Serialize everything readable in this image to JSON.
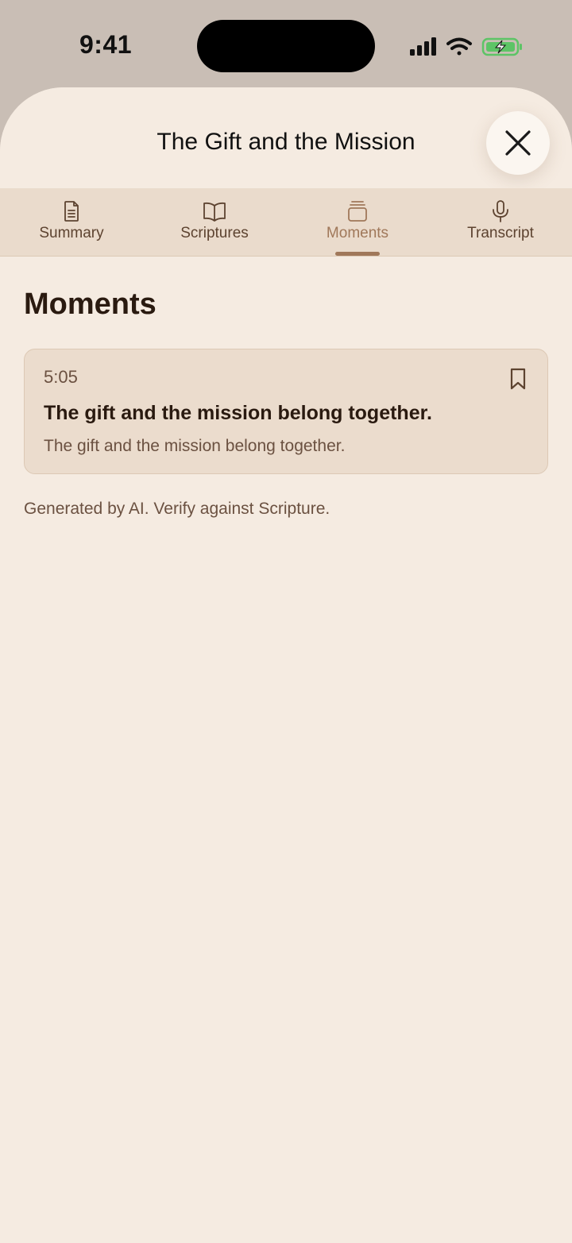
{
  "status_bar": {
    "time": "9:41",
    "icons": [
      "cellular-signal-icon",
      "wifi-icon",
      "battery-charging-icon"
    ]
  },
  "sheet": {
    "title": "The Gift and the Mission",
    "close_icon": "close-icon"
  },
  "tabs": [
    {
      "label": "Summary",
      "icon": "document-icon",
      "active": false
    },
    {
      "label": "Scriptures",
      "icon": "book-icon",
      "active": false
    },
    {
      "label": "Moments",
      "icon": "stack-icon",
      "active": true
    },
    {
      "label": "Transcript",
      "icon": "microphone-icon",
      "active": false
    }
  ],
  "main": {
    "section_title": "Moments",
    "moments": [
      {
        "time": "5:05",
        "headline": "The gift and the mission belong together.",
        "body": "The gift and the mission belong together.",
        "icon": "bookmark-icon"
      }
    ],
    "disclaimer": "Generated by AI. Verify against Scripture."
  },
  "colors": {
    "background": "#f5ebe1",
    "tab_bar": "#eadbcc",
    "accent": "#a0785a",
    "card": "#ebdccd",
    "text_primary": "#2a1a10",
    "text_secondary": "#6b5141",
    "battery_green": "#5dc466"
  }
}
